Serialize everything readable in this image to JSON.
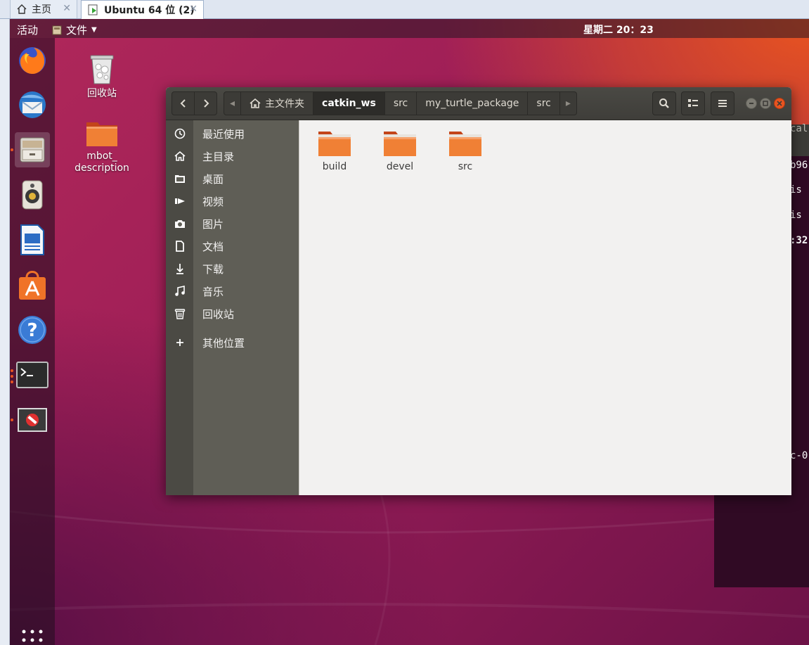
{
  "host": {
    "tabs": [
      {
        "label": "主页"
      },
      {
        "label": "Ubuntu 64 位 (2)"
      }
    ],
    "close_glyph": "✕"
  },
  "topbar": {
    "activities": "活动",
    "app_menu": "文件",
    "clock": "星期二 20：23"
  },
  "dock": {
    "items": [
      "firefox-icon",
      "thunderbird-icon",
      "files-icon",
      "rhythmbox-icon",
      "writer-icon",
      "software-icon",
      "help-icon",
      "terminal-icon",
      "blocked-app-icon"
    ],
    "show_apps": "show-applications-icon"
  },
  "desktop": {
    "icons": [
      {
        "label": "回收站"
      },
      {
        "label": "mbot_\ndescription"
      }
    ]
  },
  "terminal_peek": {
    "lines": [
      "cal",
      "b96",
      "is",
      "is",
      ":32",
      "c-0"
    ]
  },
  "files": {
    "path": [
      {
        "label": "主文件夹"
      },
      {
        "label": "catkin_ws"
      },
      {
        "label": "src"
      },
      {
        "label": "my_turtle_package"
      },
      {
        "label": "src"
      }
    ],
    "current_index": 1,
    "sidebar": [
      {
        "label": "最近使用",
        "icon": "clock-icon"
      },
      {
        "label": "主目录",
        "icon": "home-icon"
      },
      {
        "label": "桌面",
        "icon": "desktop-folder-icon"
      },
      {
        "label": "视频",
        "icon": "video-icon"
      },
      {
        "label": "图片",
        "icon": "camera-icon"
      },
      {
        "label": "文档",
        "icon": "document-icon"
      },
      {
        "label": "下载",
        "icon": "download-icon"
      },
      {
        "label": "音乐",
        "icon": "music-icon"
      },
      {
        "label": "回收站",
        "icon": "trash-icon"
      },
      {
        "label": "其他位置",
        "icon": "plus-icon"
      }
    ],
    "items": [
      {
        "label": "build"
      },
      {
        "label": "devel"
      },
      {
        "label": "src"
      }
    ]
  },
  "colors": {
    "ubuntu_orange": "#e95420",
    "header_dark": "#3f3e3a",
    "sidebar_bg": "#5f5e56",
    "folder_orange": "#f08035"
  }
}
